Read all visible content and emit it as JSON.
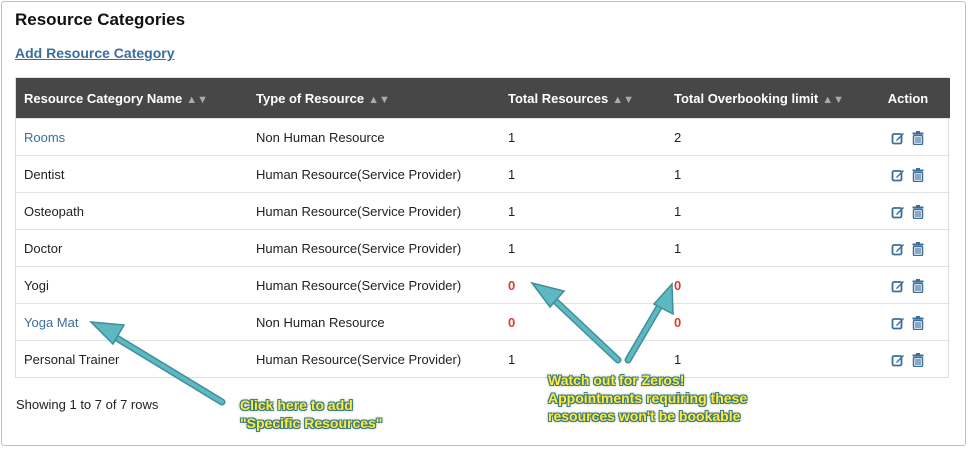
{
  "page": {
    "title": "Resource Categories",
    "add_link": "Add Resource Category"
  },
  "table": {
    "headers": [
      "Resource Category Name",
      "Type of Resource",
      "Total Resources",
      "Total Overbooking limit",
      "Action"
    ],
    "rows": [
      {
        "name": "Rooms",
        "type": "Non Human Resource",
        "total": "1",
        "overbooking": "2"
      },
      {
        "name": "Dentist",
        "type": "Human Resource(Service Provider)",
        "total": "1",
        "overbooking": "1"
      },
      {
        "name": "Osteopath",
        "type": "Human Resource(Service Provider)",
        "total": "1",
        "overbooking": "1"
      },
      {
        "name": "Doctor",
        "type": "Human Resource(Service Provider)",
        "total": "1",
        "overbooking": "1"
      },
      {
        "name": "Yogi",
        "type": "Human Resource(Service Provider)",
        "total": "0",
        "overbooking": "0"
      },
      {
        "name": "Yoga Mat",
        "type": "Non Human Resource",
        "total": "0",
        "overbooking": "0"
      },
      {
        "name": "Personal Trainer",
        "type": "Human Resource(Service Provider)",
        "total": "1",
        "overbooking": "1"
      }
    ]
  },
  "footer": {
    "showing": "Showing 1 to 7 of 7 rows"
  },
  "annotations": {
    "left_line1": "Click here to add",
    "left_line2": "\"Specific Resources\"",
    "right_line1": "Watch out for Zeros!",
    "right_line2": "Appointments requiring these",
    "right_line3": "resources won't be bookable"
  },
  "colors": {
    "link": "#3c6e9c",
    "header_bg": "#474747",
    "zero": "#e0392b",
    "callout_text": "#ffeb3b",
    "arrow": "#5db8c2"
  },
  "icons": {
    "edit": "edit-icon",
    "delete": "trash-icon",
    "sort": "sort-icon"
  }
}
